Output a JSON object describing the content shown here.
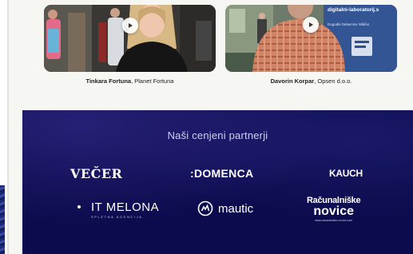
{
  "testimonials": [
    {
      "name": "Tinkara Fortuna",
      "company": ", Planet Fortuna"
    },
    {
      "name": "Davorin Korpar",
      "company": ", Opsen d.o.o.",
      "sign_text": "digitalni-laboratorij.s",
      "sign_menu": "Dogodki  Delavnice  Wikibo"
    }
  ],
  "partners": {
    "title": "Naši cenjeni partnerji",
    "logos": {
      "vecer": "VEČER",
      "domenca": ":DOMENCA",
      "kauch": "KAUCH",
      "itmelona": "IT MELONA",
      "itmelona_sub": "SPLETNA AGENCIJA",
      "mautic": "mautic",
      "racun_top": "Računalniške",
      "racun_main": "novice",
      "racun_url": "www.racunalniske-novice.com"
    }
  },
  "colors": {
    "partners_bg": "#0c0b4d",
    "page_bg": "#f6f6f3"
  },
  "icons": [
    "play-icon",
    "itmelona-logo-icon",
    "mautic-logo-icon"
  ]
}
